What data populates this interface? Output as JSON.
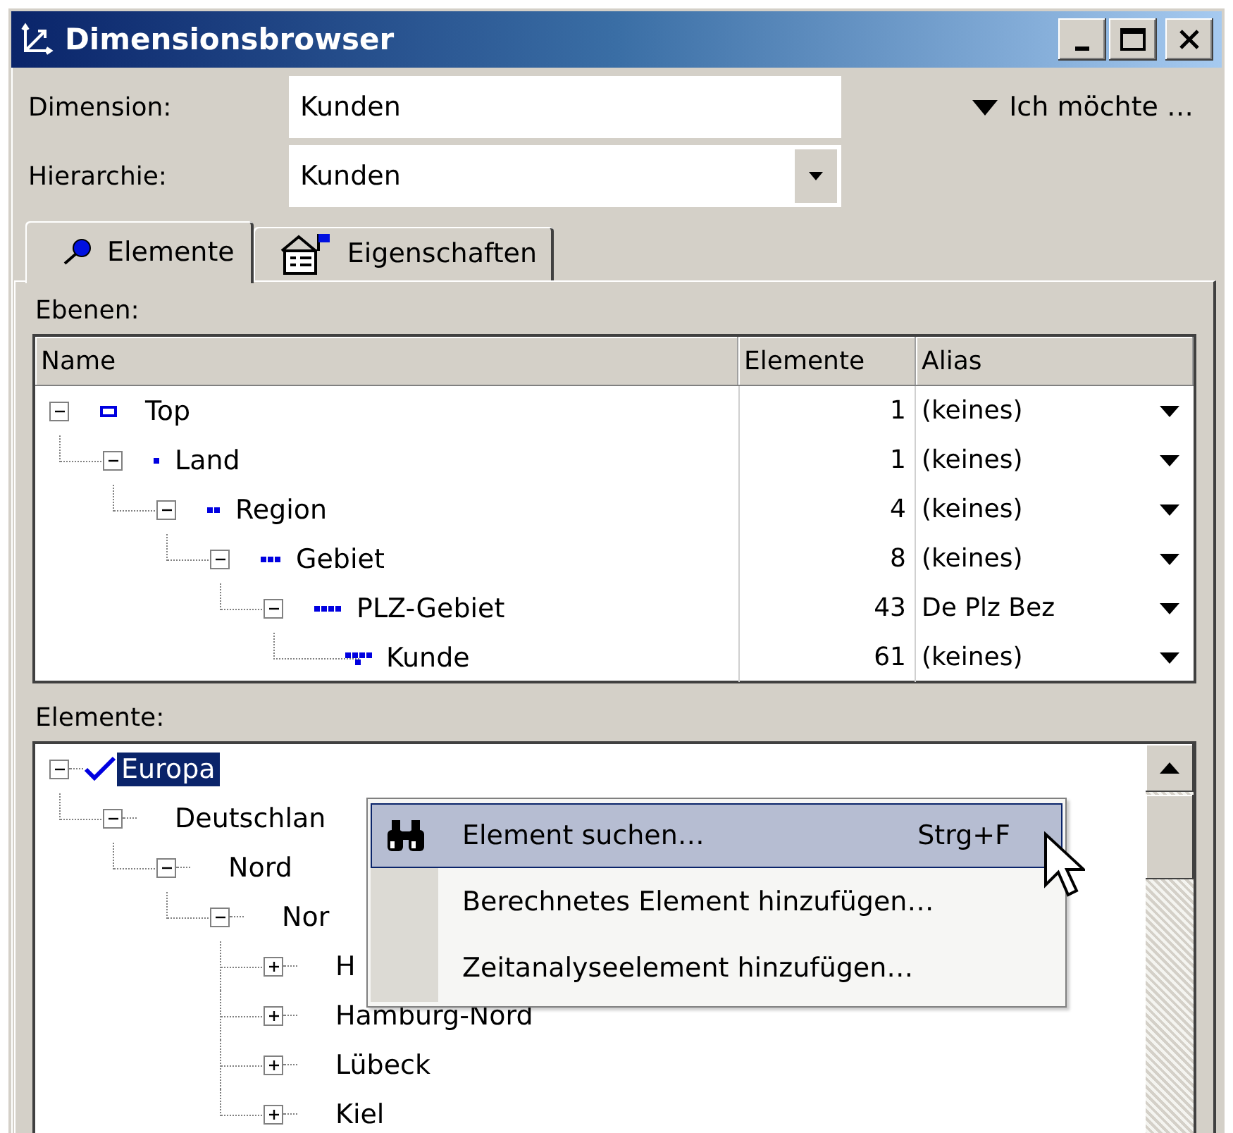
{
  "window": {
    "title": "Dimensionsbrowser"
  },
  "fields": [
    {
      "label": "Dimension:",
      "value": "Kunden",
      "kind": "text"
    },
    {
      "label": "Hierarchie:",
      "value": "Kunden",
      "kind": "combo"
    }
  ],
  "menu_link": {
    "label": "Ich möchte …"
  },
  "tabs": [
    {
      "label": "Elemente",
      "selected": true
    },
    {
      "label": "Eigenschaften",
      "selected": false
    }
  ],
  "levels": {
    "label": "Ebenen:",
    "columns": [
      "Name",
      "Elemente",
      "Alias"
    ],
    "rows": [
      {
        "name": "Top",
        "count": "1",
        "alias": "(keines)",
        "expanded": true,
        "children": [
          {
            "name": "Land",
            "count": "1",
            "alias": "(keines)",
            "expanded": true,
            "children": [
              {
                "name": "Region",
                "count": "4",
                "alias": "(keines)",
                "expanded": true,
                "children": [
                  {
                    "name": "Gebiet",
                    "count": "8",
                    "alias": "(keines)",
                    "expanded": true,
                    "children": [
                      {
                        "name": "PLZ-Gebiet",
                        "count": "43",
                        "alias": "De Plz Bez",
                        "expanded": true,
                        "children": [
                          {
                            "name": "Kunde",
                            "count": "61",
                            "alias": "(keines)"
                          }
                        ]
                      }
                    ]
                  }
                ]
              }
            ]
          }
        ]
      }
    ]
  },
  "elements": {
    "label": "Elemente:",
    "tree": [
      {
        "name": "Europa",
        "expanded": true,
        "checked": true,
        "selected": true,
        "children": [
          {
            "name": "Deutschlan",
            "expanded": true,
            "checked": false,
            "selected": false,
            "children": [
              {
                "name": "Nord",
                "expanded": true,
                "checked": false,
                "selected": false,
                "children": [
                  {
                    "name": "Nor",
                    "expanded": true,
                    "checked": false,
                    "selected": false,
                    "children": [
                      {
                        "name": "H",
                        "expanded": false,
                        "checked": false,
                        "selected": false
                      },
                      {
                        "name": "Hamburg-Nord",
                        "expanded": false,
                        "checked": false,
                        "selected": false
                      },
                      {
                        "name": "Lübeck",
                        "expanded": false,
                        "checked": false,
                        "selected": false
                      },
                      {
                        "name": "Kiel",
                        "expanded": false,
                        "checked": false,
                        "selected": false
                      }
                    ]
                  }
                ]
              }
            ]
          }
        ]
      }
    ]
  },
  "context_menu": {
    "items": [
      {
        "label": "Element suchen…",
        "shortcut": "Strg+F",
        "selected": true,
        "kind": "search"
      },
      {
        "label": "Berechnetes Element hinzufügen…",
        "selected": false,
        "kind": "plain"
      },
      {
        "label": "Zeitanalyseelement hinzufügen…",
        "selected": false,
        "kind": "plain"
      }
    ]
  }
}
